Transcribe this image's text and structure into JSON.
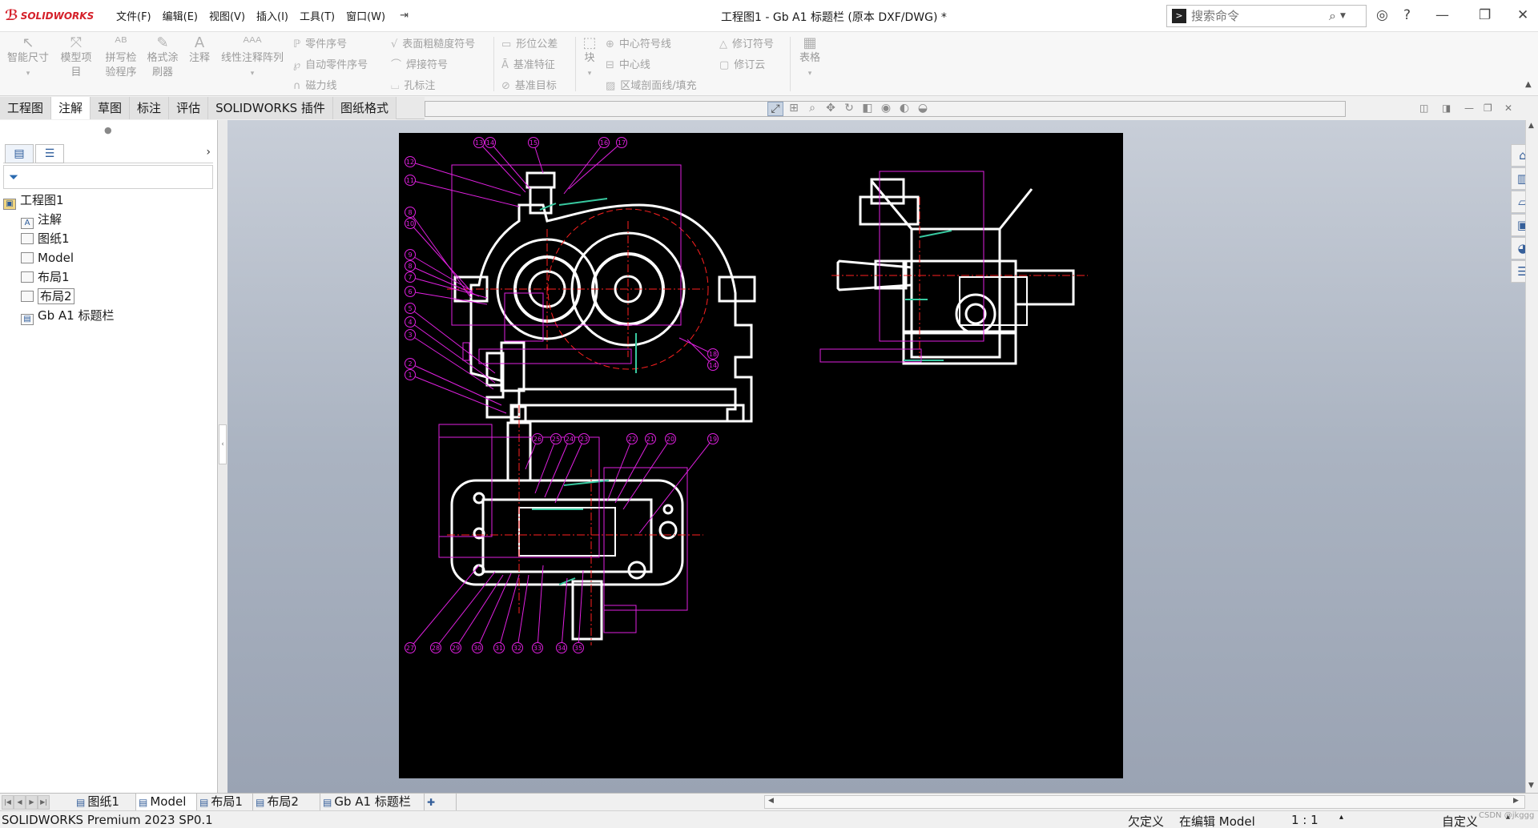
{
  "app": {
    "name": "SOLIDWORKS",
    "logo_ds": "DS",
    "title": "工程图1 - Gb A1 标题栏 (原本 DXF/DWG) *"
  },
  "menu": [
    "文件(F)",
    "编辑(E)",
    "视图(V)",
    "插入(I)",
    "工具(T)",
    "窗口(W)"
  ],
  "search": {
    "placeholder": "搜索命令"
  },
  "ribbon": {
    "big": [
      {
        "label1": "智能尺",
        "label2": "寸"
      },
      {
        "label1": "模型项",
        "label2": "目"
      },
      {
        "label1": "拼写检",
        "label2": "验程序"
      },
      {
        "label1": "格式涂",
        "label2": "刷器"
      },
      {
        "label1": "注释",
        "label2": ""
      },
      {
        "label1": "线性注释阵列",
        "label2": ""
      }
    ],
    "col1": [
      "零件序号",
      "自动零件序号",
      "磁力线"
    ],
    "col2": [
      "表面粗糙度符号",
      "焊接符号",
      "孔标注"
    ],
    "col3": [
      "形位公差",
      "基准特征",
      "基准目标"
    ],
    "block": "块",
    "col4": [
      "中心符号线",
      "中心线",
      "区域剖面线/填充"
    ],
    "col5": [
      "修订符号",
      "修订云"
    ],
    "table": "表格"
  },
  "tabs": [
    "工程图",
    "注解",
    "草图",
    "标注",
    "评估",
    "SOLIDWORKS 插件",
    "图纸格式"
  ],
  "tree": {
    "root": "工程图1",
    "items": [
      "注解",
      "图纸1",
      "Model",
      "布局1",
      "布局2",
      "Gb A1 标题栏"
    ]
  },
  "sheets": [
    "图纸1",
    "Model",
    "布局1",
    "布局2",
    "Gb A1 标题栏"
  ],
  "status": {
    "product": "SOLIDWORKS Premium 2023 SP0.1",
    "state": "欠定义",
    "editing": "在编辑 Model",
    "scale": "1 : 1",
    "custom": "自定义"
  },
  "watermark": "CSDN @jkggg",
  "balloons": {
    "top": [
      "13",
      "14",
      "15",
      "16",
      "17"
    ],
    "left": [
      "12",
      "11",
      "8",
      "10",
      "9",
      "8",
      "7",
      "6",
      "5",
      "4",
      "3",
      "2",
      "1"
    ],
    "right": [
      "18",
      "14"
    ],
    "bottom_top": [
      "26",
      "25",
      "24",
      "23",
      "22",
      "21",
      "20",
      "19"
    ],
    "bottom_row": [
      "27",
      "28",
      "29",
      "30",
      "31",
      "32",
      "33",
      "34",
      "35"
    ]
  },
  "colors": {
    "balloon": "#e020e0",
    "line": "#ffffff",
    "center": "#ff2020",
    "hatch": "#38c9a0"
  }
}
